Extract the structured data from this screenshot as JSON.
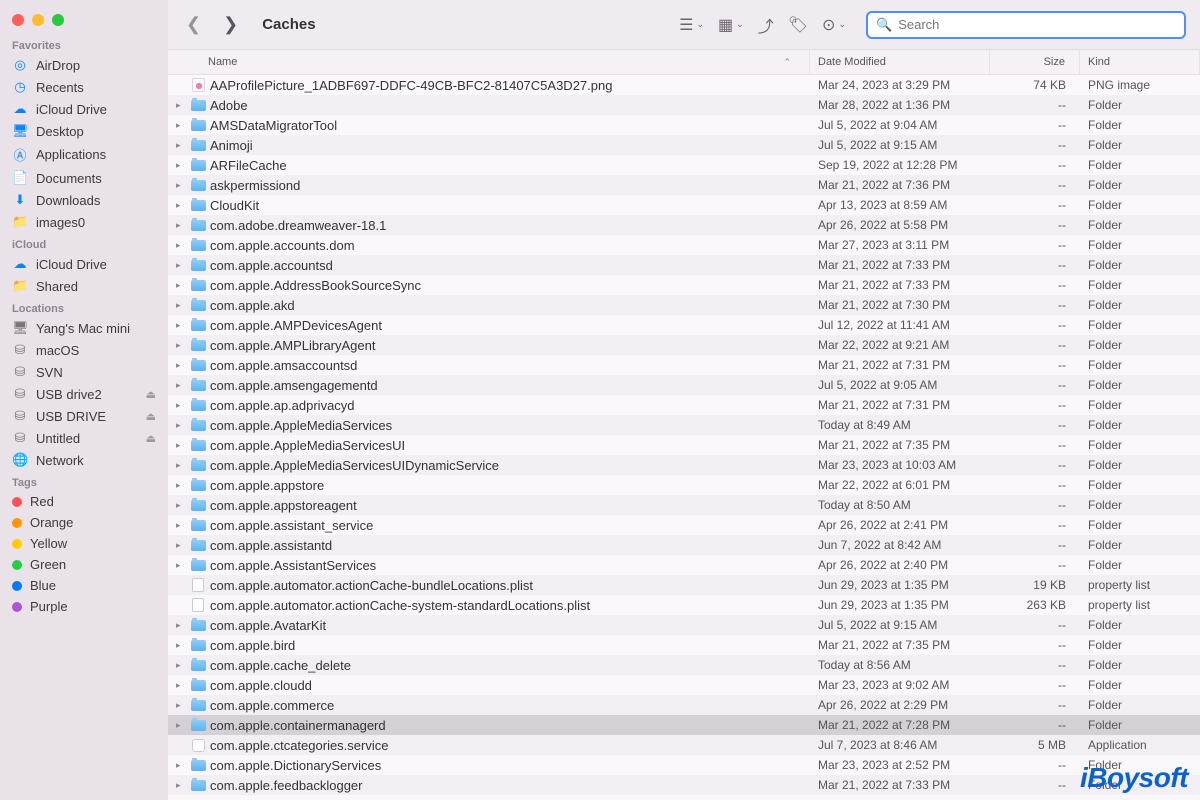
{
  "window": {
    "title": "Caches"
  },
  "search": {
    "placeholder": "Search"
  },
  "sidebar": {
    "sections": [
      {
        "heading": "Favorites",
        "items": [
          {
            "icon": "airdrop",
            "label": "AirDrop"
          },
          {
            "icon": "clock",
            "label": "Recents"
          },
          {
            "icon": "cloud",
            "label": "iCloud Drive"
          },
          {
            "icon": "desktop",
            "label": "Desktop"
          },
          {
            "icon": "apps",
            "label": "Applications"
          },
          {
            "icon": "doc",
            "label": "Documents"
          },
          {
            "icon": "down",
            "label": "Downloads"
          },
          {
            "icon": "folder",
            "label": "images0"
          }
        ]
      },
      {
        "heading": "iCloud",
        "items": [
          {
            "icon": "cloud",
            "label": "iCloud Drive"
          },
          {
            "icon": "shared",
            "label": "Shared"
          }
        ]
      },
      {
        "heading": "Locations",
        "items": [
          {
            "icon": "mac",
            "label": "Yang's Mac mini",
            "gray": true
          },
          {
            "icon": "disk",
            "label": "macOS",
            "gray": true
          },
          {
            "icon": "disk",
            "label": "SVN",
            "gray": true
          },
          {
            "icon": "disk",
            "label": "USB drive2",
            "gray": true,
            "eject": true
          },
          {
            "icon": "disk",
            "label": "USB DRIVE",
            "gray": true,
            "eject": true
          },
          {
            "icon": "disk",
            "label": "Untitled",
            "gray": true,
            "eject": true
          },
          {
            "icon": "globe",
            "label": "Network",
            "gray": true
          }
        ]
      },
      {
        "heading": "Tags",
        "items": [
          {
            "tag": "#ff5257",
            "label": "Red"
          },
          {
            "tag": "#ff9500",
            "label": "Orange"
          },
          {
            "tag": "#ffcc00",
            "label": "Yellow"
          },
          {
            "tag": "#28cd41",
            "label": "Green"
          },
          {
            "tag": "#007aff",
            "label": "Blue"
          },
          {
            "tag": "#af52de",
            "label": "Purple"
          }
        ]
      }
    ]
  },
  "columns": {
    "name": "Name",
    "date": "Date Modified",
    "size": "Size",
    "kind": "Kind"
  },
  "rows": [
    {
      "type": "png",
      "name": "AAProfilePicture_1ADBF697-DDFC-49CB-BFC2-81407C5A3D27.png",
      "date": "Mar 24, 2023 at 3:29 PM",
      "size": "74 KB",
      "kind": "PNG image"
    },
    {
      "type": "folder",
      "name": "Adobe",
      "date": "Mar 28, 2022 at 1:36 PM",
      "size": "--",
      "kind": "Folder"
    },
    {
      "type": "folder",
      "name": "AMSDataMigratorTool",
      "date": "Jul 5, 2022 at 9:04 AM",
      "size": "--",
      "kind": "Folder"
    },
    {
      "type": "folder",
      "name": "Animoji",
      "date": "Jul 5, 2022 at 9:15 AM",
      "size": "--",
      "kind": "Folder"
    },
    {
      "type": "folder",
      "name": "ARFileCache",
      "date": "Sep 19, 2022 at 12:28 PM",
      "size": "--",
      "kind": "Folder"
    },
    {
      "type": "folder",
      "name": "askpermissiond",
      "date": "Mar 21, 2022 at 7:36 PM",
      "size": "--",
      "kind": "Folder"
    },
    {
      "type": "folder",
      "name": "CloudKit",
      "date": "Apr 13, 2023 at 8:59 AM",
      "size": "--",
      "kind": "Folder"
    },
    {
      "type": "folder",
      "name": "com.adobe.dreamweaver-18.1",
      "date": "Apr 26, 2022 at 5:58 PM",
      "size": "--",
      "kind": "Folder"
    },
    {
      "type": "folder",
      "name": "com.apple.accounts.dom",
      "date": "Mar 27, 2023 at 3:11 PM",
      "size": "--",
      "kind": "Folder"
    },
    {
      "type": "folder",
      "name": "com.apple.accountsd",
      "date": "Mar 21, 2022 at 7:33 PM",
      "size": "--",
      "kind": "Folder"
    },
    {
      "type": "folder",
      "name": "com.apple.AddressBookSourceSync",
      "date": "Mar 21, 2022 at 7:33 PM",
      "size": "--",
      "kind": "Folder"
    },
    {
      "type": "folder",
      "name": "com.apple.akd",
      "date": "Mar 21, 2022 at 7:30 PM",
      "size": "--",
      "kind": "Folder"
    },
    {
      "type": "folder",
      "name": "com.apple.AMPDevicesAgent",
      "date": "Jul 12, 2022 at 11:41 AM",
      "size": "--",
      "kind": "Folder"
    },
    {
      "type": "folder",
      "name": "com.apple.AMPLibraryAgent",
      "date": "Mar 22, 2022 at 9:21 AM",
      "size": "--",
      "kind": "Folder"
    },
    {
      "type": "folder",
      "name": "com.apple.amsaccountsd",
      "date": "Mar 21, 2022 at 7:31 PM",
      "size": "--",
      "kind": "Folder"
    },
    {
      "type": "folder",
      "name": "com.apple.amsengagementd",
      "date": "Jul 5, 2022 at 9:05 AM",
      "size": "--",
      "kind": "Folder"
    },
    {
      "type": "folder",
      "name": "com.apple.ap.adprivacyd",
      "date": "Mar 21, 2022 at 7:31 PM",
      "size": "--",
      "kind": "Folder"
    },
    {
      "type": "folder",
      "name": "com.apple.AppleMediaServices",
      "date": "Today at 8:49 AM",
      "size": "--",
      "kind": "Folder"
    },
    {
      "type": "folder",
      "name": "com.apple.AppleMediaServicesUI",
      "date": "Mar 21, 2022 at 7:35 PM",
      "size": "--",
      "kind": "Folder"
    },
    {
      "type": "folder",
      "name": "com.apple.AppleMediaServicesUIDynamicService",
      "date": "Mar 23, 2023 at 10:03 AM",
      "size": "--",
      "kind": "Folder"
    },
    {
      "type": "folder",
      "name": "com.apple.appstore",
      "date": "Mar 22, 2022 at 6:01 PM",
      "size": "--",
      "kind": "Folder"
    },
    {
      "type": "folder",
      "name": "com.apple.appstoreagent",
      "date": "Today at 8:50 AM",
      "size": "--",
      "kind": "Folder"
    },
    {
      "type": "folder",
      "name": "com.apple.assistant_service",
      "date": "Apr 26, 2022 at 2:41 PM",
      "size": "--",
      "kind": "Folder"
    },
    {
      "type": "folder",
      "name": "com.apple.assistantd",
      "date": "Jun 7, 2022 at 8:42 AM",
      "size": "--",
      "kind": "Folder"
    },
    {
      "type": "folder",
      "name": "com.apple.AssistantServices",
      "date": "Apr 26, 2022 at 2:40 PM",
      "size": "--",
      "kind": "Folder"
    },
    {
      "type": "doc",
      "name": "com.apple.automator.actionCache-bundleLocations.plist",
      "date": "Jun 29, 2023 at 1:35 PM",
      "size": "19 KB",
      "kind": "property list"
    },
    {
      "type": "doc",
      "name": "com.apple.automator.actionCache-system-standardLocations.plist",
      "date": "Jun 29, 2023 at 1:35 PM",
      "size": "263 KB",
      "kind": "property list"
    },
    {
      "type": "folder",
      "name": "com.apple.AvatarKit",
      "date": "Jul 5, 2022 at 9:15 AM",
      "size": "--",
      "kind": "Folder"
    },
    {
      "type": "folder",
      "name": "com.apple.bird",
      "date": "Mar 21, 2022 at 7:35 PM",
      "size": "--",
      "kind": "Folder"
    },
    {
      "type": "folder",
      "name": "com.apple.cache_delete",
      "date": "Today at 8:56 AM",
      "size": "--",
      "kind": "Folder"
    },
    {
      "type": "folder",
      "name": "com.apple.cloudd",
      "date": "Mar 23, 2023 at 9:02 AM",
      "size": "--",
      "kind": "Folder"
    },
    {
      "type": "folder",
      "name": "com.apple.commerce",
      "date": "Apr 26, 2022 at 2:29 PM",
      "size": "--",
      "kind": "Folder"
    },
    {
      "type": "folder",
      "name": "com.apple.containermanagerd",
      "date": "Mar 21, 2022 at 7:28 PM",
      "size": "--",
      "kind": "Folder",
      "selected": true
    },
    {
      "type": "app",
      "name": "com.apple.ctcategories.service",
      "date": "Jul 7, 2023 at 8:46 AM",
      "size": "5 MB",
      "kind": "Application"
    },
    {
      "type": "folder",
      "name": "com.apple.DictionaryServices",
      "date": "Mar 23, 2023 at 2:52 PM",
      "size": "--",
      "kind": "Folder"
    },
    {
      "type": "folder",
      "name": "com.apple.feedbacklogger",
      "date": "Mar 21, 2022 at 7:33 PM",
      "size": "--",
      "kind": "Folder"
    }
  ],
  "watermark": "iBoysoft"
}
